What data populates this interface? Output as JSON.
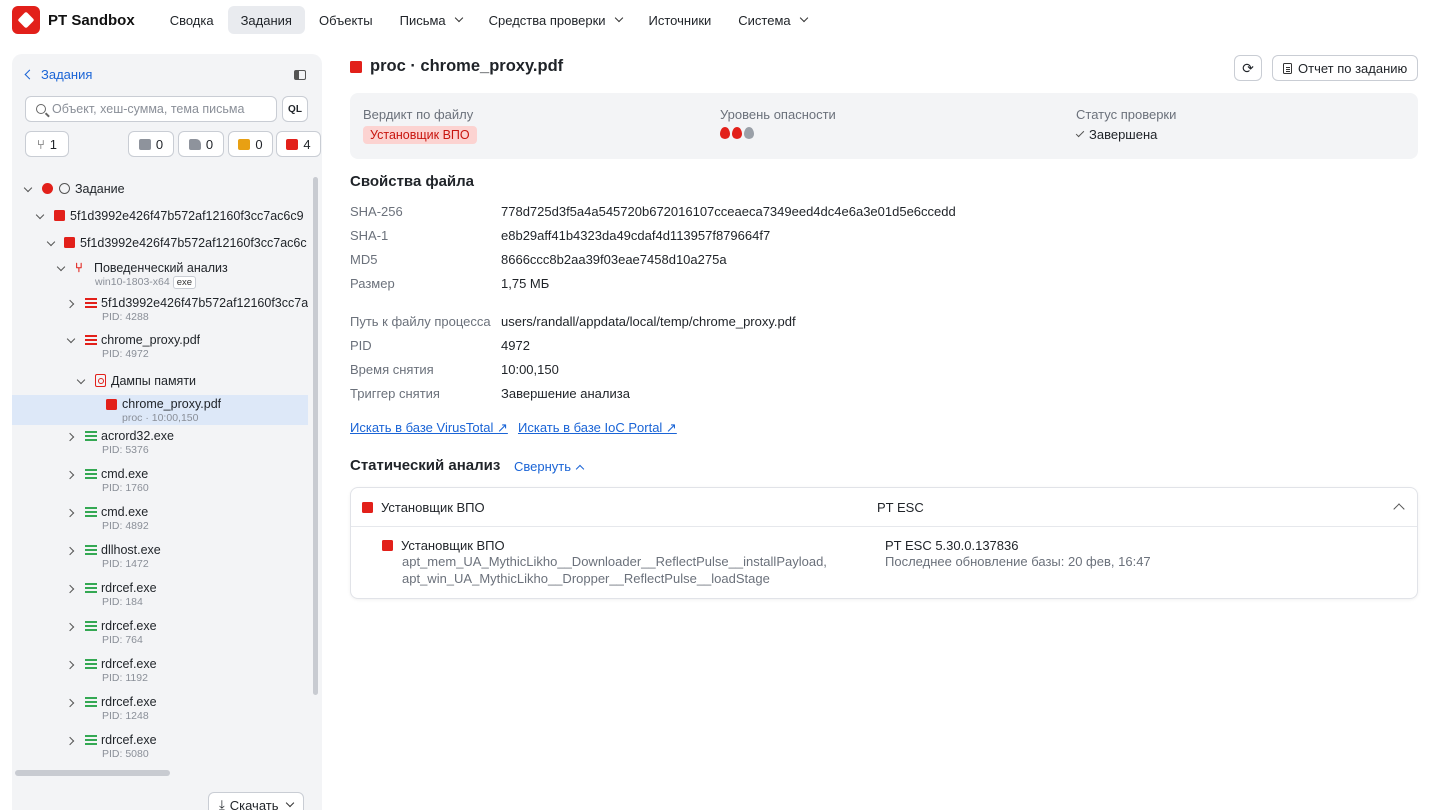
{
  "app": {
    "name": "PT Sandbox"
  },
  "nav": [
    {
      "label": "Сводка",
      "caret": false,
      "active": false
    },
    {
      "label": "Задания",
      "caret": false,
      "active": true
    },
    {
      "label": "Объекты",
      "caret": false,
      "active": false
    },
    {
      "label": "Письма",
      "caret": true,
      "active": false
    },
    {
      "label": "Средства проверки",
      "caret": true,
      "active": false
    },
    {
      "label": "Источники",
      "caret": false,
      "active": false
    },
    {
      "label": "Система",
      "caret": true,
      "active": false
    }
  ],
  "left": {
    "back_label": "Задания",
    "search_placeholder": "Объект, хеш-сумма, тема письма",
    "ql_label": "QL",
    "counters": {
      "branches": "1",
      "gray": "0",
      "gray_doc": "0",
      "orange": "0",
      "red": "4"
    },
    "download_label": "Скачать",
    "tree": {
      "task": "Задание",
      "file1": "5f1d3992e426f47b572af12160f3cc7ac6c9",
      "file2": "5f1d3992e426f47b572af12160f3cc7ac6c",
      "behav": {
        "label": "Поведенческий анализ",
        "sub": "win10-1803-x64",
        "tag": "exe"
      },
      "procs": [
        {
          "label": "5f1d3992e426f47b572af12160f3cc7a",
          "pid": "PID: 4288"
        },
        {
          "label": "chrome_proxy.pdf",
          "pid": "PID: 4972"
        }
      ],
      "dumps": "Дампы памяти",
      "selected": {
        "label": "chrome_proxy.pdf",
        "sub": "proc · 10:00,150"
      },
      "others": [
        {
          "label": "acrord32.exe",
          "pid": "PID: 5376"
        },
        {
          "label": "cmd.exe",
          "pid": "PID: 1760"
        },
        {
          "label": "cmd.exe",
          "pid": "PID: 4892"
        },
        {
          "label": "dllhost.exe",
          "pid": "PID: 1472"
        },
        {
          "label": "rdrcef.exe",
          "pid": "PID: 184"
        },
        {
          "label": "rdrcef.exe",
          "pid": "PID: 764"
        },
        {
          "label": "rdrcef.exe",
          "pid": "PID: 1192"
        },
        {
          "label": "rdrcef.exe",
          "pid": "PID: 1248"
        },
        {
          "label": "rdrcef.exe",
          "pid": "PID: 5080"
        }
      ]
    }
  },
  "main": {
    "title": "proc · chrome_proxy.pdf",
    "report_label": "Отчет по заданию",
    "verdict": {
      "file_verdict_label": "Вердикт по файлу",
      "file_verdict_value": "Установщик ВПО",
      "danger_label": "Уровень опасности",
      "danger_level": 2,
      "danger_max": 3,
      "status_label": "Статус проверки",
      "status_value": "Завершена"
    },
    "props_title": "Свойства файла",
    "props": {
      "sha256_k": "SHA-256",
      "sha256_v": "778d725d3f5a4a545720b672016107cceaeca7349eed4dc4e6a3e01d5e6ccedd",
      "sha1_k": "SHA-1",
      "sha1_v": "e8b29aff41b4323da49cdaf4d113957f879664f7",
      "md5_k": "MD5",
      "md5_v": "8666ccc8b2aa39f03eae7458d10a275a",
      "size_k": "Размер",
      "size_v": "1,75 МБ",
      "path_k": "Путь к файлу процесса",
      "path_v": "users/randall/appdata/local/temp/chrome_proxy.pdf",
      "pid_k": "PID",
      "pid_v": "4972",
      "time_k": "Время снятия",
      "time_v": "10:00,150",
      "trigger_k": "Триггер снятия",
      "trigger_v": "Завершение анализа"
    },
    "links": {
      "virustotal": "Искать в базе VirusTotal ↗",
      "ioc": "Искать в базе IoC Portal ↗"
    },
    "static": {
      "title": "Статический анализ",
      "collapse_label": "Свернуть",
      "head_left": "Установщик ВПО",
      "head_right": "PT ESC",
      "body_title": "Установщик ВПО",
      "rule1": "apt_mem_UA_MythicLikho__Downloader__ReflectPulse__installPayload,",
      "rule2": "apt_win_UA_MythicLikho__Dropper__ReflectPulse__loadStage",
      "engine": "PT ESC 5.30.0.137836",
      "db_update": "Последнее обновление базы: 20 фев, 16:47"
    }
  },
  "colors": {
    "accent": "#1a64d6",
    "danger": "#e2201a",
    "danger_bg": "#fcd3d1",
    "ok": "#34a853",
    "panel": "#f3f4f6"
  }
}
